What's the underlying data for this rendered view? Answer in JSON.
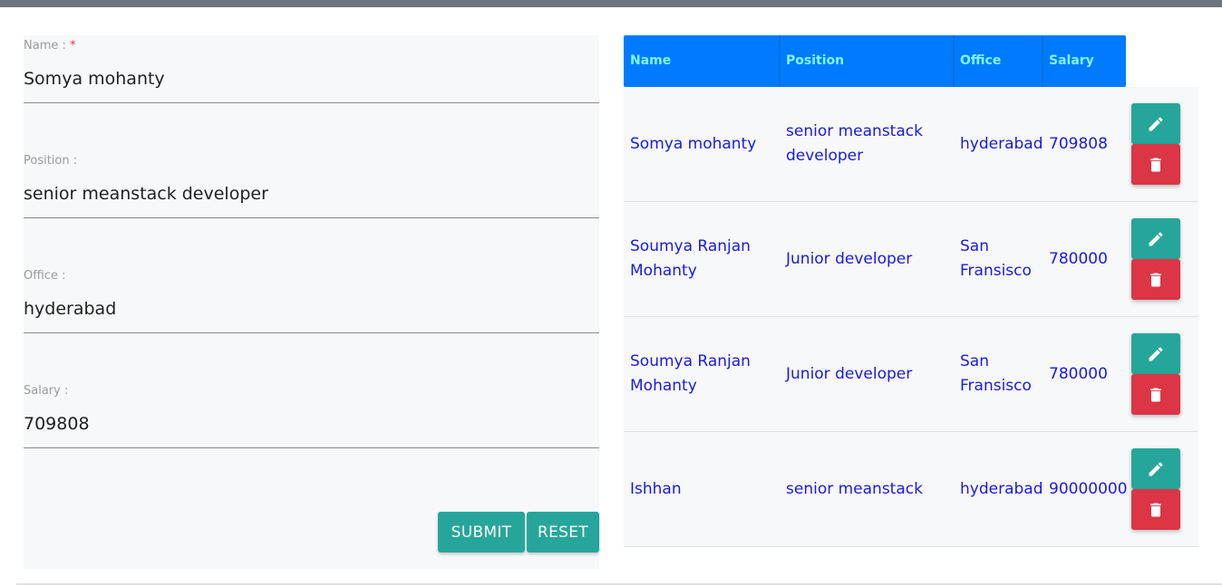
{
  "form": {
    "name_label": "Name :",
    "required_mark": "*",
    "name_value": "Somya mohanty",
    "position_label": "Position :",
    "position_value": "senior meanstack developer",
    "office_label": "Office :",
    "office_value": "hyderabad",
    "salary_label": "Salary :",
    "salary_value": "709808",
    "submit_label": "SUBMIT",
    "reset_label": "RESET"
  },
  "table": {
    "headers": [
      "Name",
      "Position",
      "Office",
      "Salary"
    ],
    "rows": [
      {
        "name": "Somya mohanty",
        "position": "senior meanstack developer",
        "office": "hyderabad",
        "salary": "709808"
      },
      {
        "name": "Soumya Ranjan Mohanty",
        "position": "Junior developer",
        "office": "San Fransisco",
        "salary": "780000"
      },
      {
        "name": "Soumya Ranjan Mohanty",
        "position": "Junior developer",
        "office": "San Fransisco",
        "salary": "780000"
      },
      {
        "name": "Ishhan",
        "position": "senior meanstack",
        "office": "hyderabad",
        "salary": "90000000"
      }
    ]
  },
  "icons": {
    "edit": "pencil-icon",
    "delete": "trash-icon"
  },
  "colors": {
    "accent_teal": "#26a69a",
    "header_blue": "#007bff",
    "header_text": "#7ff5ff",
    "danger_red": "#dc3545",
    "cell_text": "#1a1adf",
    "top_bar": "#6c757d"
  }
}
